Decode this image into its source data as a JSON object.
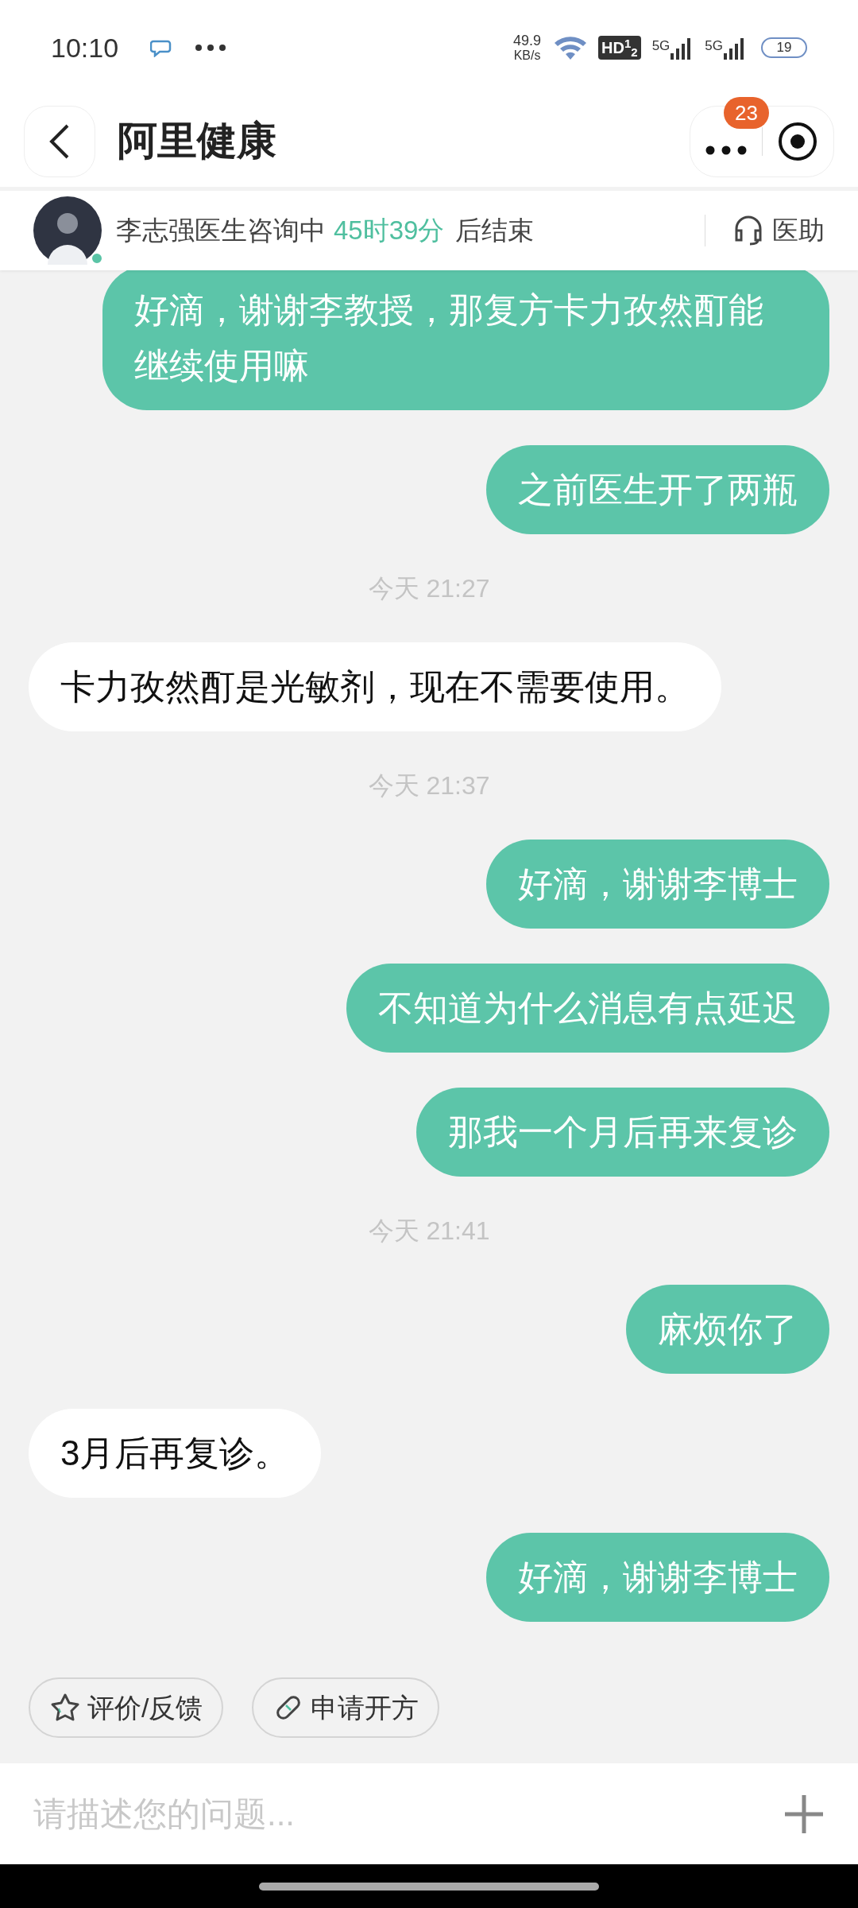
{
  "status_bar": {
    "time": "10:10",
    "speed": "49.9",
    "speed_unit": "KB/s",
    "hd": "HD$^{1}$$_{2}$",
    "networks": [
      "5G",
      "5G"
    ],
    "battery": "19"
  },
  "header": {
    "title": "阿里健康",
    "badge": "23"
  },
  "consult": {
    "prefix": "李志强医生咨询中",
    "remaining": "45时39分",
    "suffix": "后结束",
    "assistant": "医助"
  },
  "messages": [
    {
      "kind": "sent",
      "text": "好滴，谢谢李教授，那复方卡力孜然酊能继续使用嘛"
    },
    {
      "kind": "sent",
      "text": "之前医生开了两瓶"
    },
    {
      "kind": "time",
      "text": "今天 21:27"
    },
    {
      "kind": "received",
      "text": "卡力孜然酊是光敏剂，现在不需要使用。"
    },
    {
      "kind": "time",
      "text": "今天 21:37"
    },
    {
      "kind": "sent",
      "text": "好滴，谢谢李博士"
    },
    {
      "kind": "sent",
      "text": "不知道为什么消息有点延迟"
    },
    {
      "kind": "sent",
      "text": "那我一个月后再来复诊"
    },
    {
      "kind": "time",
      "text": "今天 21:41"
    },
    {
      "kind": "sent",
      "text": "麻烦你了"
    },
    {
      "kind": "received",
      "text": "3月后再复诊。"
    },
    {
      "kind": "sent",
      "text": "好滴，谢谢李博士"
    }
  ],
  "actions": [
    {
      "kind": "rate",
      "label": "评价/反馈"
    },
    {
      "kind": "prescribe",
      "label": "申请开方"
    }
  ],
  "input": {
    "placeholder": "请描述您的问题..."
  }
}
